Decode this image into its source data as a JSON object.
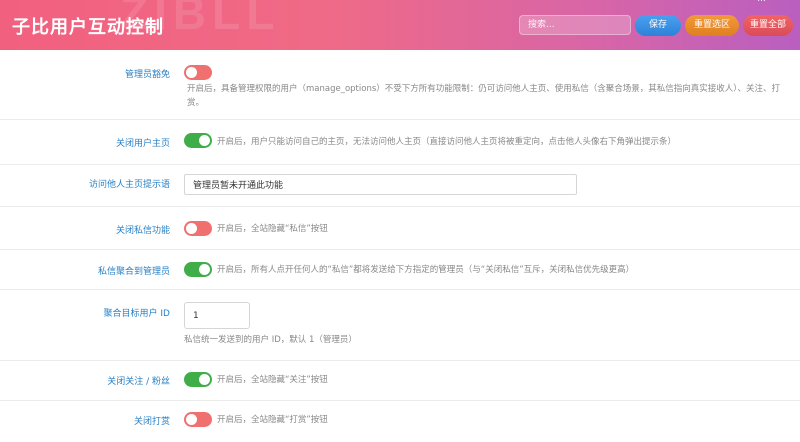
{
  "header": {
    "title": "子比用户互动控制",
    "watermark": "ZIBLL",
    "corner_text": "…",
    "search_placeholder": "搜索...",
    "save_label": "保存",
    "reset_selected_label": "重置选区",
    "reset_all_label": "重置全部"
  },
  "settings": [
    {
      "label": "管理员豁免",
      "type": "toggle",
      "state": "off",
      "desc": "开启后，具备管理权限的用户（manage_options）不受下方所有功能限制：仍可访问他人主页、使用私信（含聚合场景，其私信指向真实接收人）、关注、打赏。"
    },
    {
      "label": "关闭用户主页",
      "type": "toggle",
      "state": "on",
      "desc": "开启后，用户只能访问自己的主页，无法访问他人主页（直接访问他人主页将被重定向，点击他人头像右下角弹出提示条）"
    },
    {
      "label": "访问他人主页提示语",
      "type": "text",
      "value": "管理员暂未开通此功能"
    },
    {
      "label": "关闭私信功能",
      "type": "toggle",
      "state": "off",
      "desc": "开启后，全站隐藏“私信”按钮"
    },
    {
      "label": "私信聚合到管理员",
      "type": "toggle",
      "state": "on",
      "desc": "开启后，所有人点开任何人的“私信”都将发送给下方指定的管理员（与“关闭私信”互斥，关闭私信优先级更高）"
    },
    {
      "label": "聚合目标用户 ID",
      "type": "number",
      "value": "1",
      "desc": "私信统一发送到的用户 ID，默认 1（管理员）"
    },
    {
      "label": "关闭关注 / 粉丝",
      "type": "toggle",
      "state": "on",
      "desc": "开启后，全站隐藏“关注”按钮"
    },
    {
      "label": "关闭打赏",
      "type": "toggle",
      "state": "off",
      "desc": "开启后，全站隐藏“打赏”按钮"
    }
  ],
  "colors": {
    "toggle_on": "#3fae49",
    "toggle_off": "#f07070",
    "label": "#2780c6",
    "header_start": "#f2607f",
    "header_end": "#b95fc0"
  }
}
